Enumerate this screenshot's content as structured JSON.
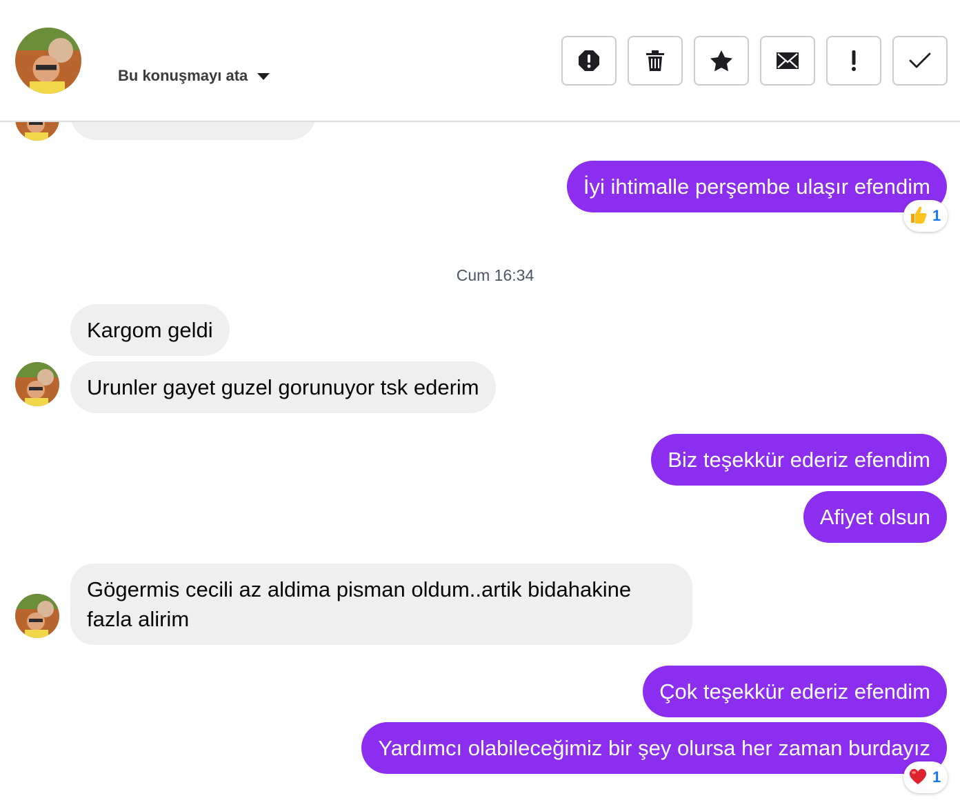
{
  "header": {
    "assign_label": "Bu konuşmayı ata",
    "actions": [
      {
        "name": "spam-button",
        "icon": "alert-circle-icon"
      },
      {
        "name": "delete-button",
        "icon": "trash-icon"
      },
      {
        "name": "star-button",
        "icon": "star-icon"
      },
      {
        "name": "mark-unread-button",
        "icon": "envelope-icon"
      },
      {
        "name": "follow-up-button",
        "icon": "exclamation-icon"
      },
      {
        "name": "mark-done-button",
        "icon": "check-icon"
      }
    ]
  },
  "conversation": {
    "partial_previous": "",
    "messages": [
      {
        "direction": "out",
        "text": "İyi ihtimalle perşembe ulaşır efendim",
        "reaction": {
          "emoji": "thumbs-up-icon",
          "count": "1"
        }
      },
      {
        "direction": "in",
        "text": "Kargom geldi"
      },
      {
        "direction": "in",
        "text": "Urunler gayet guzel gorunuyor tsk ederim"
      },
      {
        "direction": "out",
        "text": "Biz teşekkür ederiz efendim"
      },
      {
        "direction": "out",
        "text": "Afiyet olsun"
      },
      {
        "direction": "in",
        "text": "Gögermis cecili az aldima pisman oldum..artik bidahakine fazla alirim"
      },
      {
        "direction": "out",
        "text": "Çok teşekkür ederiz efendim"
      },
      {
        "direction": "out",
        "text": "Yardımcı olabileceğimiz bir şey olursa her zaman burdayız",
        "reaction": {
          "emoji": "heart-icon",
          "count": "1"
        }
      }
    ],
    "timestamp": "Cum 16:34"
  },
  "colors": {
    "outgoing_bubble": "#8c2ef0",
    "incoming_bubble": "#efefef",
    "reaction_count": "#1877f2"
  }
}
